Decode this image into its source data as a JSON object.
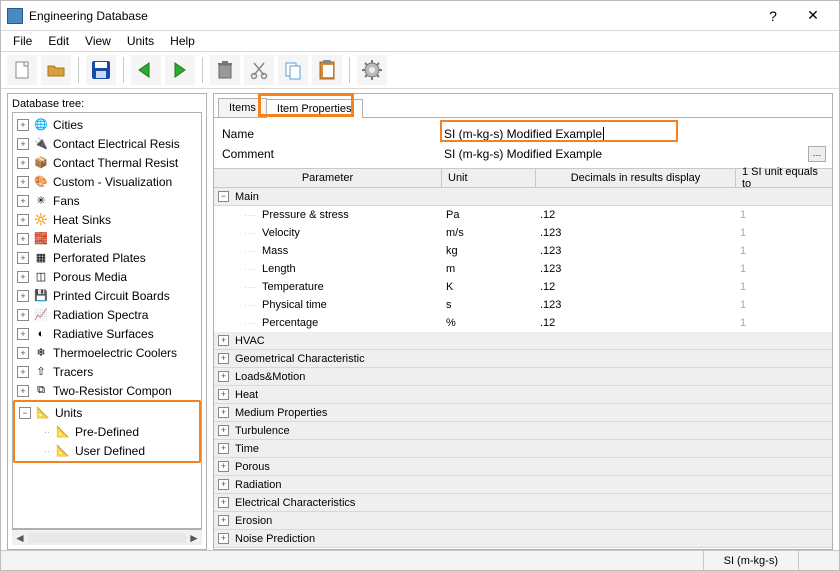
{
  "window": {
    "title": "Engineering Database"
  },
  "menu": [
    "File",
    "Edit",
    "View",
    "Units",
    "Help"
  ],
  "sidebar": {
    "label": "Database tree:",
    "items": [
      {
        "label": "Cities",
        "icon": "🌐"
      },
      {
        "label": "Contact Electrical Resis",
        "icon": "🔌"
      },
      {
        "label": "Contact Thermal Resist",
        "icon": "📦"
      },
      {
        "label": "Custom - Visualization",
        "icon": "🎨"
      },
      {
        "label": "Fans",
        "icon": "✳"
      },
      {
        "label": "Heat Sinks",
        "icon": "🔆"
      },
      {
        "label": "Materials",
        "icon": "🧱"
      },
      {
        "label": "Perforated Plates",
        "icon": "▦"
      },
      {
        "label": "Porous Media",
        "icon": "◫"
      },
      {
        "label": "Printed Circuit Boards",
        "icon": "💾"
      },
      {
        "label": "Radiation Spectra",
        "icon": "📈"
      },
      {
        "label": "Radiative Surfaces",
        "icon": "◐"
      },
      {
        "label": "Thermoelectric Coolers",
        "icon": "❄"
      },
      {
        "label": "Tracers",
        "icon": "⇧"
      },
      {
        "label": "Two-Resistor Compon",
        "icon": "⧉"
      }
    ],
    "units": {
      "label": "Units",
      "children": [
        "Pre-Defined",
        "User Defined"
      ]
    }
  },
  "tabs": {
    "items": "Items",
    "properties": "Item Properties"
  },
  "form": {
    "name_label": "Name",
    "name_value": "SI (m-kg-s)  Modified Example",
    "comment_label": "Comment",
    "comment_value": "SI (m-kg-s)  Modified Example"
  },
  "columns": {
    "param": "Parameter",
    "unit": "Unit",
    "dec": "Decimals in results display",
    "si": "1 SI unit equals to"
  },
  "main_group": "Main",
  "rows": [
    {
      "p": "Pressure & stress",
      "u": "Pa",
      "d": ".12",
      "s": "1"
    },
    {
      "p": "Velocity",
      "u": "m/s",
      "d": ".123",
      "s": "1"
    },
    {
      "p": "Mass",
      "u": "kg",
      "d": ".123",
      "s": "1"
    },
    {
      "p": "Length",
      "u": "m",
      "d": ".123",
      "s": "1"
    },
    {
      "p": "Temperature",
      "u": "K",
      "d": ".12",
      "s": "1"
    },
    {
      "p": "Physical time",
      "u": "s",
      "d": ".123",
      "s": "1"
    },
    {
      "p": "Percentage",
      "u": "%",
      "d": ".12",
      "s": "1"
    }
  ],
  "groups": [
    "HVAC",
    "Geometrical Characteristic",
    "Loads&Motion",
    "Heat",
    "Medium Properties",
    "Turbulence",
    "Time",
    "Porous",
    "Radiation",
    "Electrical Characteristics",
    "Erosion",
    "Noise Prediction"
  ],
  "status": "SI (m-kg-s)"
}
